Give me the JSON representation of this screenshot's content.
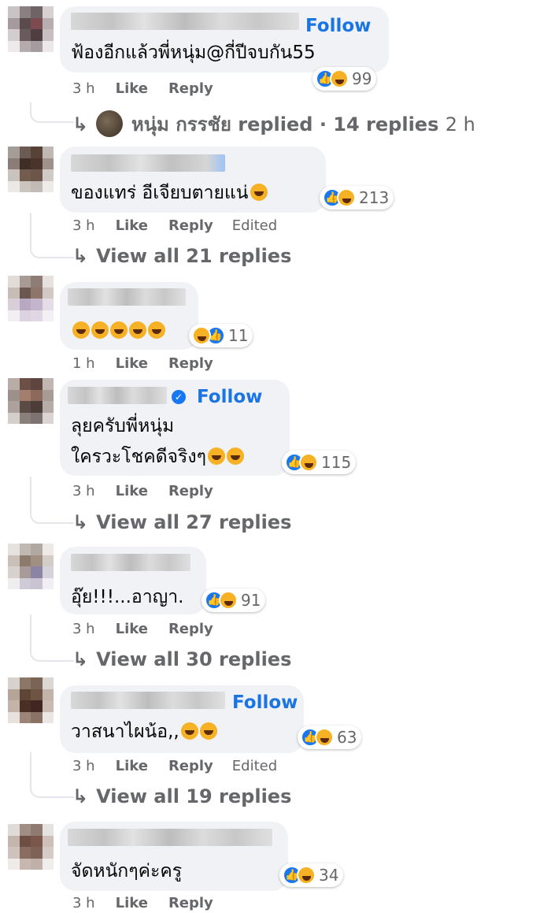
{
  "comments": [
    {
      "text": "ฟ้องอีกแล้วพี่หนุ่ม@กี่ปีจบกัน55",
      "follow": "Follow",
      "time": "3 h",
      "like": "Like",
      "reply": "Reply",
      "reaction_count": "99"
    },
    {
      "text": "ของแทร่ อีเจียบตายแน่",
      "time": "3 h",
      "like": "Like",
      "reply": "Reply",
      "edited": "Edited",
      "reaction_count": "213",
      "view_replies": "View all 21 replies"
    },
    {
      "text": "",
      "time": "1 h",
      "like": "Like",
      "reply": "Reply",
      "reaction_count": "11"
    },
    {
      "text_line1": "ลุยครับพี่หนุ่ม",
      "text_line2": "ใครวะโชคดีจริงๆ",
      "follow": "Follow",
      "time": "3 h",
      "like": "Like",
      "reply": "Reply",
      "reaction_count": "115",
      "view_replies": "View all 27 replies"
    },
    {
      "text": "อุ๊ย!!!...อาญา.",
      "time": "3 h",
      "like": "Like",
      "reply": "Reply",
      "reaction_count": "91",
      "view_replies": "View all 30 replies"
    },
    {
      "text": "วาสนาไผน้อ,,",
      "follow": "Follow",
      "time": "3 h",
      "like": "Like",
      "reply": "Reply",
      "edited": "Edited",
      "reaction_count": "63",
      "view_replies": "View all 19 replies"
    },
    {
      "text": "จัดหนักๆค่ะครู",
      "time": "3 h",
      "like": "Like",
      "reply": "Reply",
      "reaction_count": "34"
    }
  ],
  "reply_summary": {
    "name": "หนุ่ม กรรชัย",
    "text": "replied · 14 replies",
    "time": "2 h"
  },
  "icons": {
    "reply_arrow": "↳",
    "like_icon": "👍"
  },
  "colors": {
    "accent": "#1b74e4",
    "muted": "#65676b",
    "bubble": "#f0f2f5"
  }
}
